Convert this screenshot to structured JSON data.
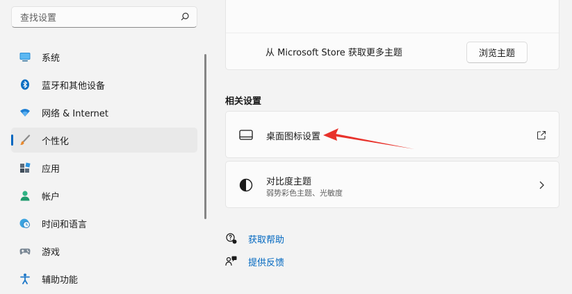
{
  "search": {
    "placeholder": "查找设置"
  },
  "nav": {
    "items": [
      {
        "label": "系统",
        "icon": "monitor-icon"
      },
      {
        "label": "蓝牙和其他设备",
        "icon": "bluetooth-icon"
      },
      {
        "label": "网络 & Internet",
        "icon": "wifi-icon"
      },
      {
        "label": "个性化",
        "icon": "brush-icon",
        "active": true
      },
      {
        "label": "应用",
        "icon": "apps-icon"
      },
      {
        "label": "帐户",
        "icon": "person-icon"
      },
      {
        "label": "时间和语言",
        "icon": "clock-globe-icon"
      },
      {
        "label": "游戏",
        "icon": "gamepad-icon"
      },
      {
        "label": "辅助功能",
        "icon": "accessibility-icon"
      }
    ]
  },
  "store": {
    "text": "从 Microsoft Store 获取更多主题",
    "button": "浏览主题"
  },
  "related": {
    "title": "相关设置",
    "items": [
      {
        "title": "桌面图标设置",
        "icon": "desktop-icon",
        "end_icon": "external-link-icon"
      },
      {
        "title": "对比度主题",
        "subtitle": "弱势彩色主题、光敏度",
        "icon": "contrast-icon",
        "end_icon": "chevron-right-icon"
      }
    ]
  },
  "links": [
    {
      "label": "获取帮助",
      "icon": "help-icon"
    },
    {
      "label": "提供反馈",
      "icon": "feedback-icon"
    }
  ],
  "colors": {
    "accent": "#0067c0",
    "annotation_arrow": "#e8322b"
  }
}
